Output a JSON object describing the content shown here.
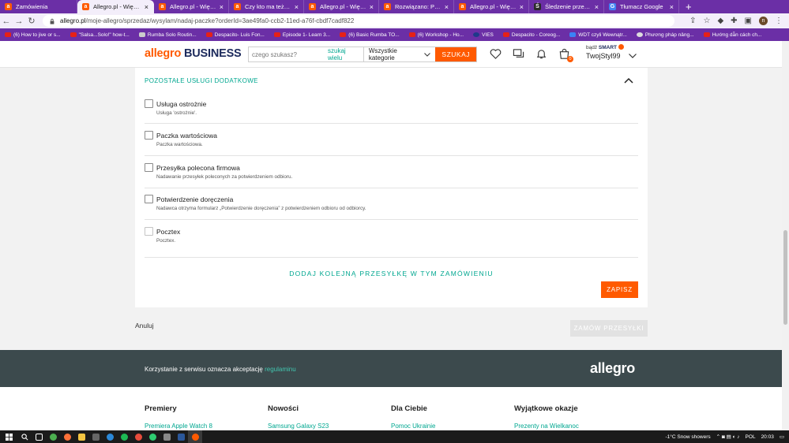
{
  "browser": {
    "tabs": [
      {
        "title": "Zamówienia",
        "color": "#ff5a00"
      },
      {
        "title": "Allegro.pl - Więcej niż",
        "color": "#ff5a00"
      },
      {
        "title": "Allegro.pl - Więcej niż",
        "color": "#ff5a00"
      },
      {
        "title": "Czy kto ma też kłopot",
        "color": "#ff5a00"
      },
      {
        "title": "Allegro.pl - Więcej niż",
        "color": "#ff5a00"
      },
      {
        "title": "Rozwiązano: Przy prób",
        "color": "#ff5a00"
      },
      {
        "title": "Allegro.pl - Więcej niż",
        "color": "#ff5a00"
      },
      {
        "title": "Śledzenie przesyłek In",
        "color": "#2b2b2b"
      },
      {
        "title": "Tłumacz Google",
        "color": "#4285f4"
      }
    ],
    "active_tab": 1,
    "url_host": "allegro.pl",
    "url_path": "/moje-allegro/sprzedaz/wysylam/nadaj-paczke?orderId=3ae49fa0-ccb2-11ed-a76f-cbdf7cadf822",
    "profile_initial": "n",
    "bookmarks": [
      "(6) How to jive or s...",
      "\"Salsa...Solo!\" how-t...",
      "Rumba Solo Routin...",
      "Despacito- Luis Fon...",
      "Episode 1- Learn 3...",
      "(6) Basic Rumba TO...",
      "(6) Workshop - Ho...",
      "VIES",
      "Despacito - Coreog...",
      "WDT czyli Wewnątr...",
      "Phương pháp nâng...",
      "Hướng dẫn cách ch..."
    ]
  },
  "header": {
    "logo_allegro": "allegro",
    "logo_business": "BUSINESS",
    "search_placeholder": "czego szukasz?",
    "search_many": "szukaj wielu",
    "category": "Wszystkie kategorie",
    "search_button": "SZUKAJ",
    "cart_count": "0",
    "smart_prefix": "bądź",
    "smart_label": "SMART",
    "username": "TwojStyl99"
  },
  "section": {
    "title": "POZOSTAŁE USŁUGI DODATKOWE",
    "options": [
      {
        "label": "Usługa ostrożnie",
        "desc": "Usługa 'ostrożnie'.",
        "checked": false
      },
      {
        "label": "Paczka wartościowa",
        "desc": "Paczka wartościowa.",
        "checked": false
      },
      {
        "label": "Przesyłka polecona firmowa",
        "desc": "Nadawanie przesyłek poleconych za potwierdzeniem odbioru.",
        "checked": false
      },
      {
        "label": "Potwierdzenie doręczenia",
        "desc": "Nadawca otrzyma formularz „Potwierdzenie doręczenia” z potwierdzeniem odbioru od odbiorcy.",
        "checked": false
      },
      {
        "label": "Pocztex",
        "desc": "Pocztex.",
        "checked": false
      }
    ],
    "add_link": "DODAJ KOLEJNĄ PRZESYŁKĘ W TYM ZAMÓWIENIU",
    "save_button": "ZAPISZ"
  },
  "actions": {
    "cancel": "Anuluj",
    "order": "ZAMÓW PRZESYŁKI"
  },
  "footer": {
    "terms_text": "Korzystanie z serwisu oznacza akceptację",
    "terms_link": "regulaminu",
    "logo": "allegro",
    "columns": [
      {
        "heading": "Premiery",
        "link": "Premiera Apple Watch 8"
      },
      {
        "heading": "Nowości",
        "link": "Samsung Galaxy S23"
      },
      {
        "heading": "Dla Ciebie",
        "link": "Pomoc Ukrainie"
      },
      {
        "heading": "Wyjątkowe okazje",
        "link": "Prezenty na Wielkanoc"
      }
    ]
  },
  "taskbar": {
    "weather": "-1°C  Snow showers",
    "language": "POL",
    "time": "20:03"
  },
  "colors": {
    "accent": "#ff5a00",
    "link": "#00a790",
    "browser_frame": "#6b2fa6",
    "footer_dark": "#3c4a4d"
  }
}
